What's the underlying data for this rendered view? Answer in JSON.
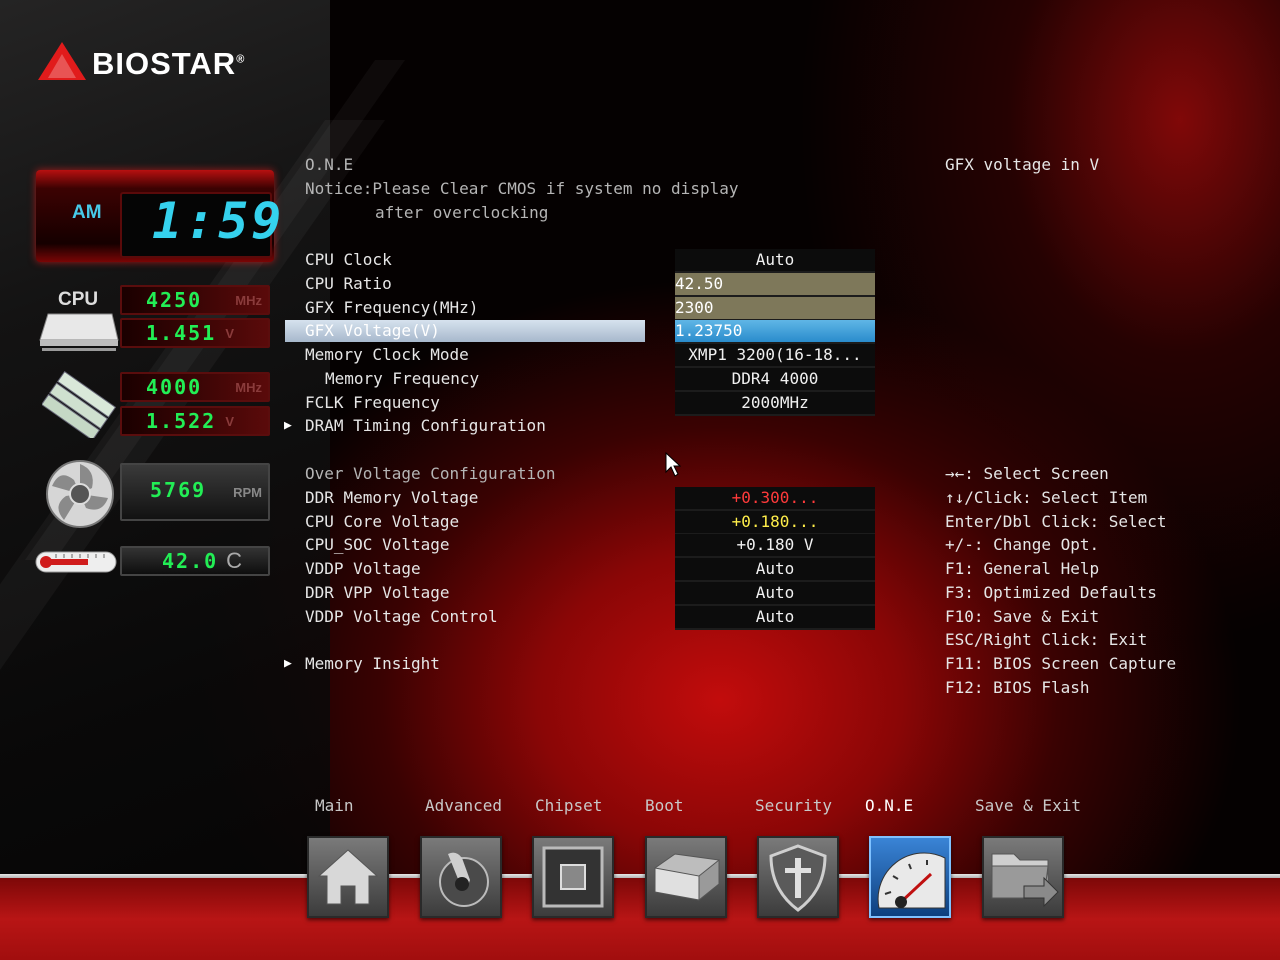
{
  "brand": {
    "name": "BIOSTAR",
    "registered": "®"
  },
  "status": {
    "ampm": "AM",
    "time": "1:59",
    "cpu_label": "CPU",
    "cpu_freq": "4250",
    "cpu_freq_unit": "MHz",
    "cpu_volt": "1.451",
    "cpu_volt_unit": "V",
    "mem_freq": "4000",
    "mem_freq_unit": "MHz",
    "mem_volt": "1.522",
    "mem_volt_unit": "V",
    "fan_rpm": "5769",
    "fan_unit": "RPM",
    "temp": "42.0",
    "temp_unit": "C"
  },
  "header": {
    "title": "O.N.E",
    "notice_line1": "Notice:Please Clear CMOS if system no display",
    "notice_line2": "after overclocking"
  },
  "settings": [
    {
      "label": "CPU Clock",
      "value": "Auto"
    },
    {
      "label": "CPU Ratio",
      "value": "42.50"
    },
    {
      "label": "GFX Frequency(MHz)",
      "value": "2300"
    },
    {
      "label": "GFX Voltage(V)",
      "value": "1.23750"
    },
    {
      "label": "Memory Clock Mode",
      "value": "XMP1 3200(16-18..."
    },
    {
      "label": "Memory Frequency",
      "value": "DDR4 4000"
    },
    {
      "label": "FCLK Frequency",
      "value": "2000MHz"
    },
    {
      "label": "DRAM Timing Configuration"
    }
  ],
  "voltage_section": {
    "title": "Over Voltage Configuration",
    "items": [
      {
        "label": "DDR Memory Voltage",
        "value": "+0.300..."
      },
      {
        "label": "CPU Core Voltage",
        "value": "+0.180..."
      },
      {
        "label": "CPU_SOC Voltage",
        "value": "+0.180 V"
      },
      {
        "label": "VDDP Voltage",
        "value": "Auto"
      },
      {
        "label": "DDR VPP Voltage",
        "value": "Auto"
      },
      {
        "label": "VDDP Voltage Control",
        "value": "Auto"
      }
    ]
  },
  "memory_insight": "Memory Insight",
  "help": {
    "description": "GFX voltage in V",
    "keys": [
      "→←: Select Screen",
      "↑↓/Click: Select Item",
      "Enter/Dbl Click: Select",
      "+/-: Change Opt.",
      "F1: General Help",
      "F3: Optimized Defaults",
      "F10: Save & Exit",
      "ESC/Right Click: Exit",
      "F11: BIOS Screen Capture",
      "F12: BIOS Flash"
    ]
  },
  "tabs": [
    {
      "label": "Main",
      "icon": "home-icon"
    },
    {
      "label": "Advanced",
      "icon": "joystick-icon"
    },
    {
      "label": "Chipset",
      "icon": "chip-icon"
    },
    {
      "label": "Boot",
      "icon": "drive-icon"
    },
    {
      "label": "Security",
      "icon": "shield-icon"
    },
    {
      "label": "O.N.E",
      "icon": "speedometer-icon",
      "active": true
    },
    {
      "label": "Save & Exit",
      "icon": "folder-exit-icon"
    }
  ],
  "colors": {
    "selection_blue": "#2a8ccc",
    "olive_value": "#7e785a",
    "warn_red": "#ff3a3a",
    "warn_yellow": "#ffee4a",
    "lcd_green": "#22ee55",
    "clock_cyan": "#35d2ee"
  }
}
